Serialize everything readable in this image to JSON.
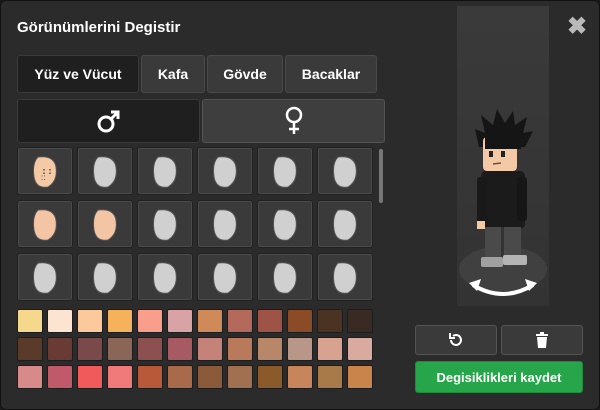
{
  "window": {
    "title": "Görünümlerini Degistir",
    "close_label": "✖"
  },
  "tabs": [
    {
      "label": "Yüz ve Vücut",
      "active": true
    },
    {
      "label": "Kafa",
      "active": false
    },
    {
      "label": "Gövde",
      "active": false
    },
    {
      "label": "Bacaklar",
      "active": false
    }
  ],
  "gender": [
    {
      "label": "male",
      "icon": "male-icon",
      "symbol": "♂",
      "active": true
    },
    {
      "label": "female",
      "icon": "female-icon",
      "symbol": "♀",
      "active": false
    }
  ],
  "parts_grid": {
    "rows": 3,
    "cols": 6,
    "selected_index": 0,
    "peach_indices": [
      6,
      7
    ]
  },
  "swatches": {
    "rows": [
      [
        "#f5d88b",
        "#fde4d0",
        "#fbc99c",
        "#f6b25a",
        "#f89e8a",
        "#d9a2a4",
        "#d08a5a",
        "#b46a5a",
        "#9d5446",
        "#8a4b26",
        "#4a3323",
        "#3a2a24"
      ],
      [
        "#5a3a28",
        "#6a3a34",
        "#7a4a4a",
        "#8a6658",
        "#8c5050",
        "#a85a62",
        "#c48278",
        "#b87a5a",
        "#b8876a",
        "#b89688",
        "#d8a290",
        "#d8aaa0"
      ],
      [
        "#d88a8a",
        "#c05a6a",
        "#f05a5a",
        "#f07a7a",
        "#b85a3a",
        "#a86a4a",
        "#8a5a3a",
        "#a07050",
        "#8a5a2a",
        "#c8845a",
        "#a87a4a",
        "#c8844a"
      ]
    ]
  },
  "actions": {
    "undo_icon": "undo-icon",
    "delete_icon": "trash-icon",
    "save_label": "Degisiklikleri kaydet"
  },
  "colors": {
    "accent": "#27a54a",
    "panel": "#2b2b2b",
    "button": "#3a3a3a"
  }
}
